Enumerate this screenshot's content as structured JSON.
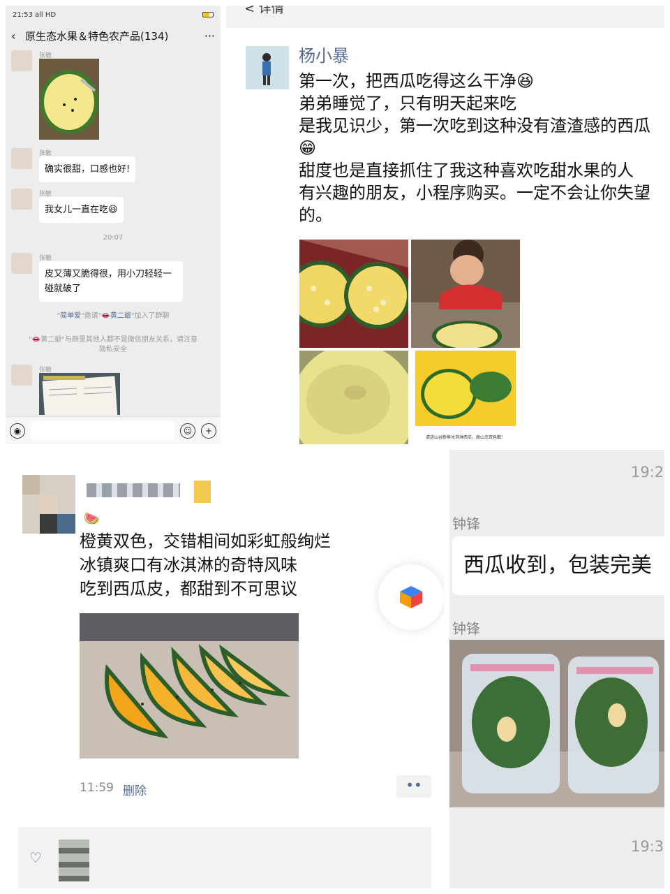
{
  "panel_a": {
    "status": {
      "time": "21:53",
      "signal": "all HD"
    },
    "title": "原生态水果＆特色农产品(134)",
    "back_icon": "chevron-left-icon",
    "more_icon": "ellipsis-icon",
    "messages": [
      {
        "sender": "张敏",
        "type": "image"
      },
      {
        "sender": "张敏",
        "text": "确实很甜，口感也好!"
      },
      {
        "sender": "张敏",
        "text": "我女儿一直在吃😆"
      },
      {
        "sender": "张敏",
        "text": "皮又薄又脆得很，用小刀轻轻一碰就破了"
      },
      {
        "sender": "张敏",
        "type": "image"
      }
    ],
    "timestamp": "20:07",
    "system_invite": {
      "inviter": "简单爱",
      "mid": "\"邀请\"",
      "invitee": "👄黄二爺",
      "suffix": "\"加入了群聊"
    },
    "system_notice": "\"👄黄二爺\"与群里其他人都不是微信朋友关系，请注意隐私安全",
    "input_icons": [
      "voice-icon",
      "emoji-icon",
      "plus-icon"
    ]
  },
  "panel_b": {
    "header": "<   详情",
    "name": "杨小暴",
    "text": "第一次，把西瓜吃得这么干净😆\n弟弟睡觉了，只有明天起来吃\n是我见识少，第一次吃到这种没有渣渣感的西瓜😁\n甜度也是直接抓住了我这种喜欢吃甜水果的人\n有兴趣的朋友，小程序购买。一定不会让你失望的。",
    "photo_caption": "请送山谷新鲜冰淇淋西瓜，高山瓜双色瓤！"
  },
  "panel_c": {
    "emoji": "🍉",
    "text": "橙黄双色，交错相间如彩虹般绚烂\n冰镇爽口有冰淇淋的奇特风味\n吃到西瓜皮，都甜到不可思议",
    "time": "11:59",
    "delete": "删除",
    "more": "••",
    "like_icon": "heart-icon"
  },
  "panel_d": {
    "time_top": "19:2",
    "sender1": "钟锋",
    "message": "西瓜收到，包装完美",
    "sender2": "钟锋",
    "time_bottom": "19:3"
  },
  "colors": {
    "link_blue": "#576b95",
    "chat_bg": "#ededed",
    "melon_yellow": "#f2a51a"
  }
}
